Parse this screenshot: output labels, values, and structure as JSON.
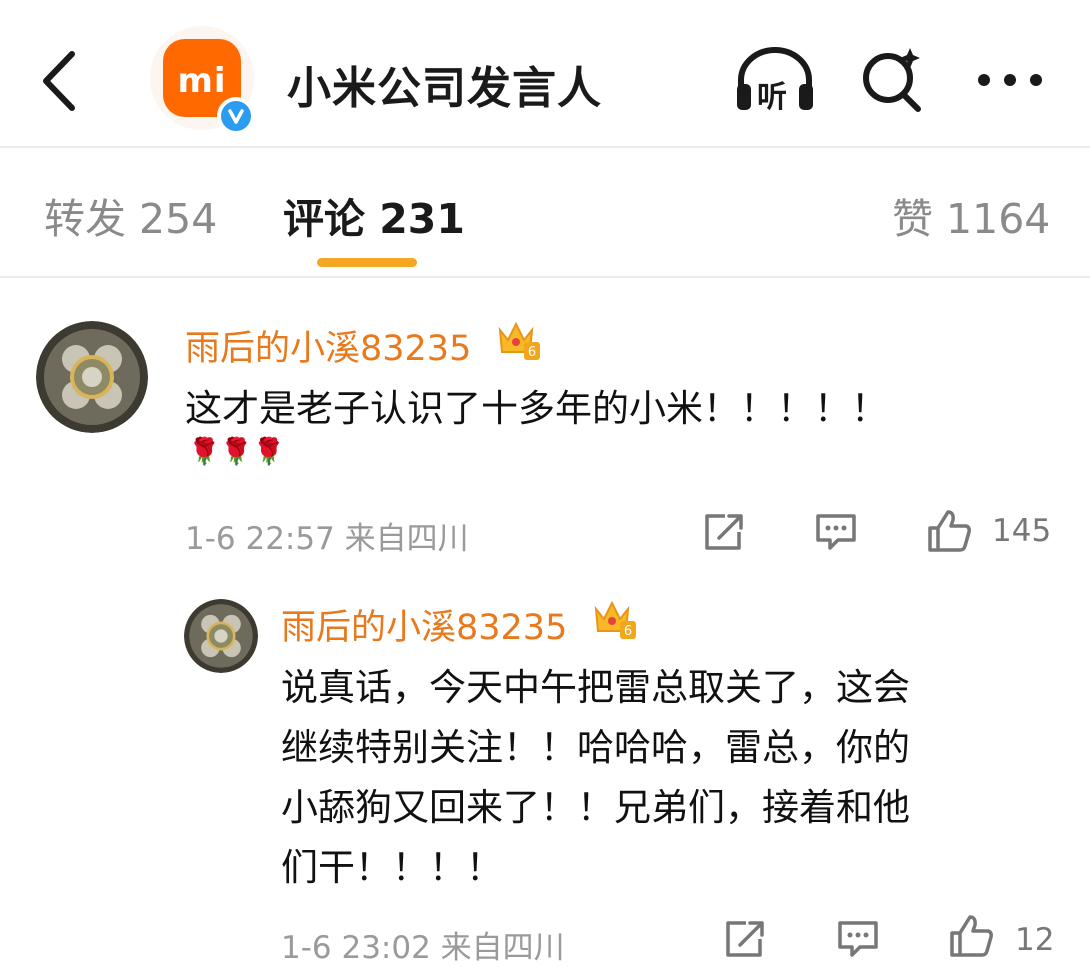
{
  "header": {
    "title": "小米公司发言人",
    "logo_text": "mi",
    "listen_label": "听"
  },
  "tabs": [
    {
      "label": "转发 254"
    },
    {
      "label": "评论 231"
    },
    {
      "label": "赞 1164"
    }
  ],
  "comments": [
    {
      "username": "雨后的小溪83235",
      "crown_level": "6",
      "text": "这才是老子认识了十多年的小米！！！！！",
      "emoji": "🌹🌹🌹",
      "meta": "1-6 22:57  来自四川",
      "likes": "145"
    },
    {
      "username": "雨后的小溪83235",
      "crown_level": "6",
      "lines": [
        "说真话，今天中午把雷总取关了，这会",
        "继续特别关注！！哈哈哈，雷总，你的",
        "小舔狗又回来了！！兄弟们，接着和他",
        "们干！！！！"
      ],
      "meta": "1-6 23:02  来自四川",
      "likes": "12"
    }
  ],
  "colors": {
    "accent": "#f5a623",
    "username": "#e87a1d",
    "brand": "#ff6900",
    "verified": "#2c9cf0"
  }
}
